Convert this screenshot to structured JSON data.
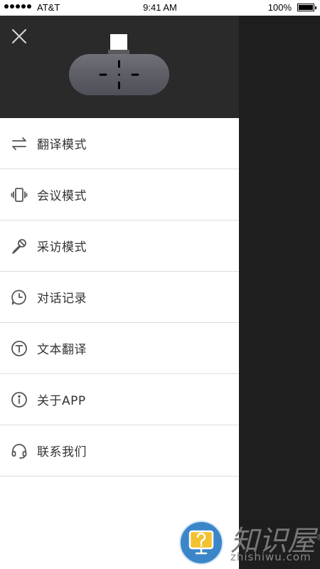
{
  "status_bar": {
    "carrier": "AT&T",
    "time": "9:41 AM",
    "battery": "100%",
    "battery_level": 1.0
  },
  "header": {
    "close_icon": "close-icon",
    "device_image": "translator-device"
  },
  "menu": {
    "items": [
      {
        "label": "翻译模式",
        "icon": "swap-arrows-icon"
      },
      {
        "label": "会议模式",
        "icon": "vibrate-phone-icon"
      },
      {
        "label": "采访模式",
        "icon": "microphone-icon"
      },
      {
        "label": "对话记录",
        "icon": "clock-bubble-icon"
      },
      {
        "label": "文本翻译",
        "icon": "text-t-icon"
      },
      {
        "label": "关于APP",
        "icon": "info-icon"
      },
      {
        "label": "联系我们",
        "icon": "headset-icon"
      }
    ]
  },
  "watermark": {
    "text": "知识屋",
    "url": "zhishiwu.com",
    "mark": "®"
  },
  "colors": {
    "header_bg": "#2a2a2a",
    "overlay_bg": "#1e1e1e",
    "menu_text": "#333333",
    "divider": "#dcdcdc",
    "icon": "#555555"
  }
}
